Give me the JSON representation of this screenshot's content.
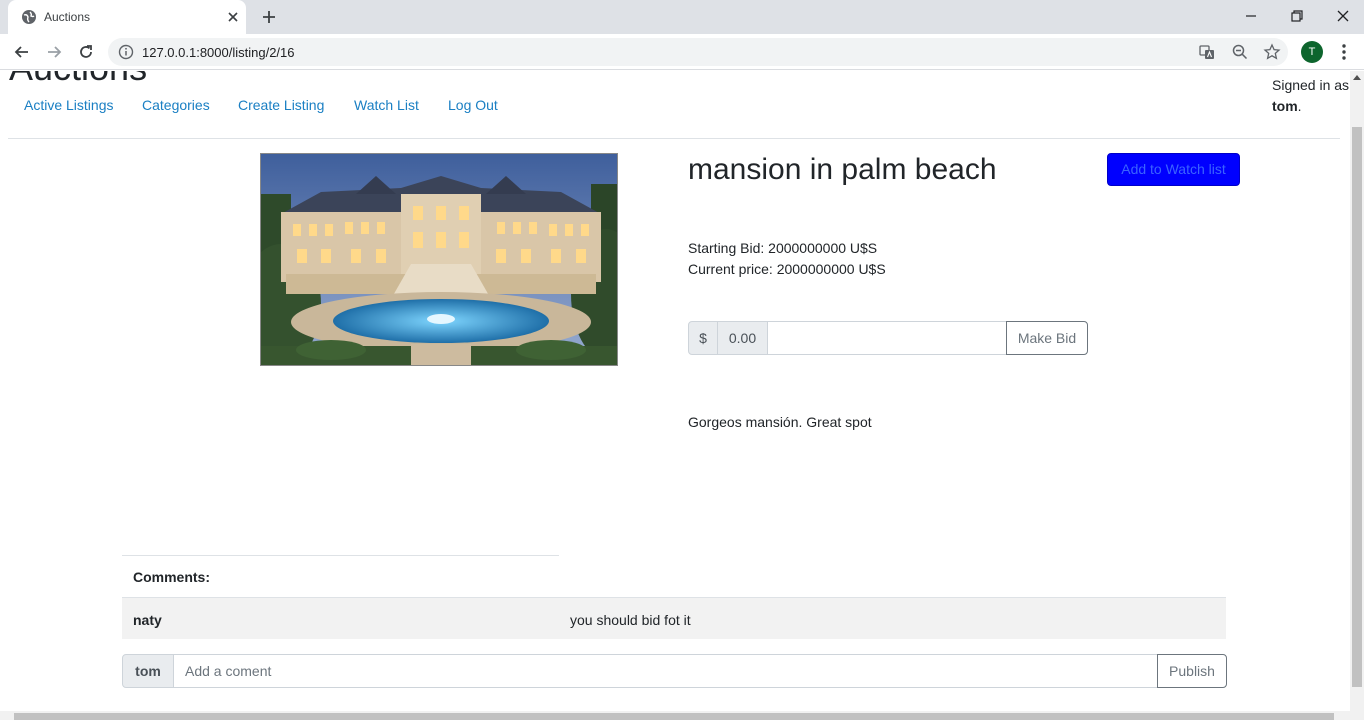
{
  "browser": {
    "tab_title": "Auctions",
    "url": "127.0.0.1:8000/listing/2/16",
    "profile_initial": "T"
  },
  "site": {
    "brand": "Auctions",
    "signed_in_prefix": "Signed in as",
    "signed_in_user": "tom",
    "signed_in_suffix": "."
  },
  "nav": [
    {
      "label": "Active Listings"
    },
    {
      "label": "Categories"
    },
    {
      "label": "Create Listing"
    },
    {
      "label": "Watch List"
    },
    {
      "label": "Log Out"
    }
  ],
  "listing": {
    "title": "mansion in palm beach",
    "watch_button": "Add to Watch list",
    "starting_bid": "Starting Bid: 2000000000 U$S",
    "current_price": "Current price: 2000000000 U$S",
    "description": "Gorgeos mansión. Great spot"
  },
  "bid": {
    "currency": "$",
    "cents": "0.00",
    "value": "",
    "button": "Make Bid"
  },
  "comments": {
    "heading": "Comments:",
    "items": [
      {
        "user": "naty",
        "text": "you should bid fot it"
      }
    ],
    "current_user": "tom",
    "placeholder": "Add a coment",
    "button": "Publish"
  },
  "colors": {
    "link": "#1a7fc3",
    "watch_button_bg": "#0000ff",
    "watch_button_text": "#3a63ff"
  }
}
